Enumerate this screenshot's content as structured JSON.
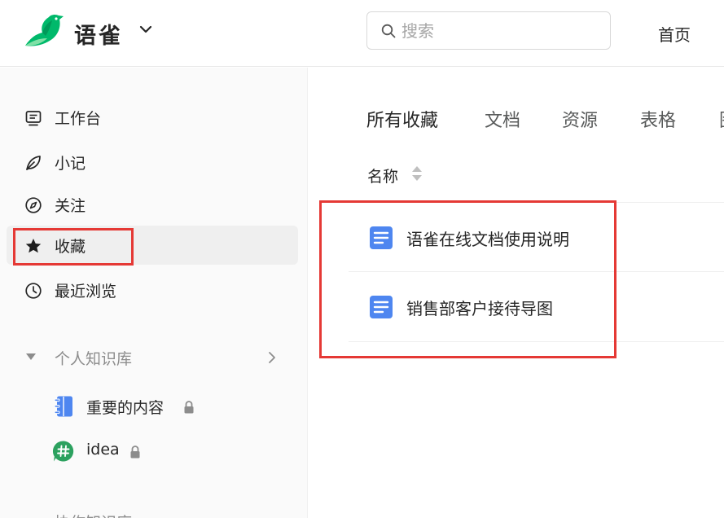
{
  "header": {
    "brand": "语雀",
    "search_placeholder": "搜索",
    "nav_home": "首页"
  },
  "sidebar": {
    "items": [
      {
        "label": "工作台",
        "icon": "workbench-icon",
        "active": false
      },
      {
        "label": "小记",
        "icon": "leaf-icon",
        "active": false
      },
      {
        "label": "关注",
        "icon": "compass-icon",
        "active": false
      },
      {
        "label": "收藏",
        "icon": "star-icon",
        "active": true
      },
      {
        "label": "最近浏览",
        "icon": "clock-icon",
        "active": false
      }
    ],
    "section": {
      "label": "个人知识库"
    },
    "knowledge_bases": [
      {
        "label": "重要的内容",
        "icon": "notebook-icon",
        "locked": true
      },
      {
        "label": "idea",
        "icon": "hash-icon",
        "locked": true
      }
    ],
    "cutoff_label": "协作知识库"
  },
  "main": {
    "tabs": [
      {
        "label": "所有收藏",
        "active": true
      },
      {
        "label": "文档",
        "active": false
      },
      {
        "label": "资源",
        "active": false
      },
      {
        "label": "表格",
        "active": false
      },
      {
        "label": "图",
        "active": false
      }
    ],
    "column_header": "名称",
    "rows": [
      {
        "title": "语雀在线文档使用说明",
        "icon": "document-icon"
      },
      {
        "title": "销售部客户接待导图",
        "icon": "document-icon"
      }
    ]
  },
  "colors": {
    "brand_green": "#00B96B",
    "doc_blue": "#4E86F0",
    "hash_green": "#2CA15F",
    "highlight_red": "#E53935"
  }
}
